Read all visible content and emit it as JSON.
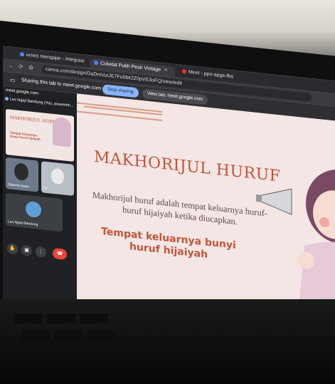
{
  "browser": {
    "tabs": [
      {
        "label": "ernes mengajar - Integrasi B"
      },
      {
        "label": "Cokelat Putih Pesir Vintage"
      },
      {
        "label": "Meet - ppo-apge-fbs"
      }
    ],
    "address": "canva.com/design/DaDmVuIJE7Fu0bk2Z0pVE3oFQ/view/edit",
    "share_text": "Sharing this tab to meet.google.com",
    "stop_label": "Stop sharing",
    "view_label": "View tab: meet.google.com"
  },
  "meet": {
    "url": "meet.google.com",
    "presenter": "Les Ngaji Bandung (You, presentin...",
    "participants": [
      {
        "name": "Sitarme Azan"
      },
      {
        "name": "Fe"
      },
      {
        "name": "Les Ngaji Bandung"
      }
    ]
  },
  "slide": {
    "title": "MAKHORIJUL HURUF",
    "body": "Makhorijul huruf adalah tempat keluarnya huruf-huruf hijaiyah ketika diucapkan.",
    "highlight": "Tempat keluarnya bunyi huruf hijaiyah"
  },
  "thumb": {
    "title": "MAKHORIJUL HURUF",
    "sub": "Tempat keluarnya bunyi huruf hijaiyah"
  },
  "colors": {
    "accent": "#c0553a",
    "slide_bg": "#f3e6e4",
    "meet_bg": "#202124",
    "stop_button": "#8ab4f8",
    "end_call": "#ea4335"
  }
}
